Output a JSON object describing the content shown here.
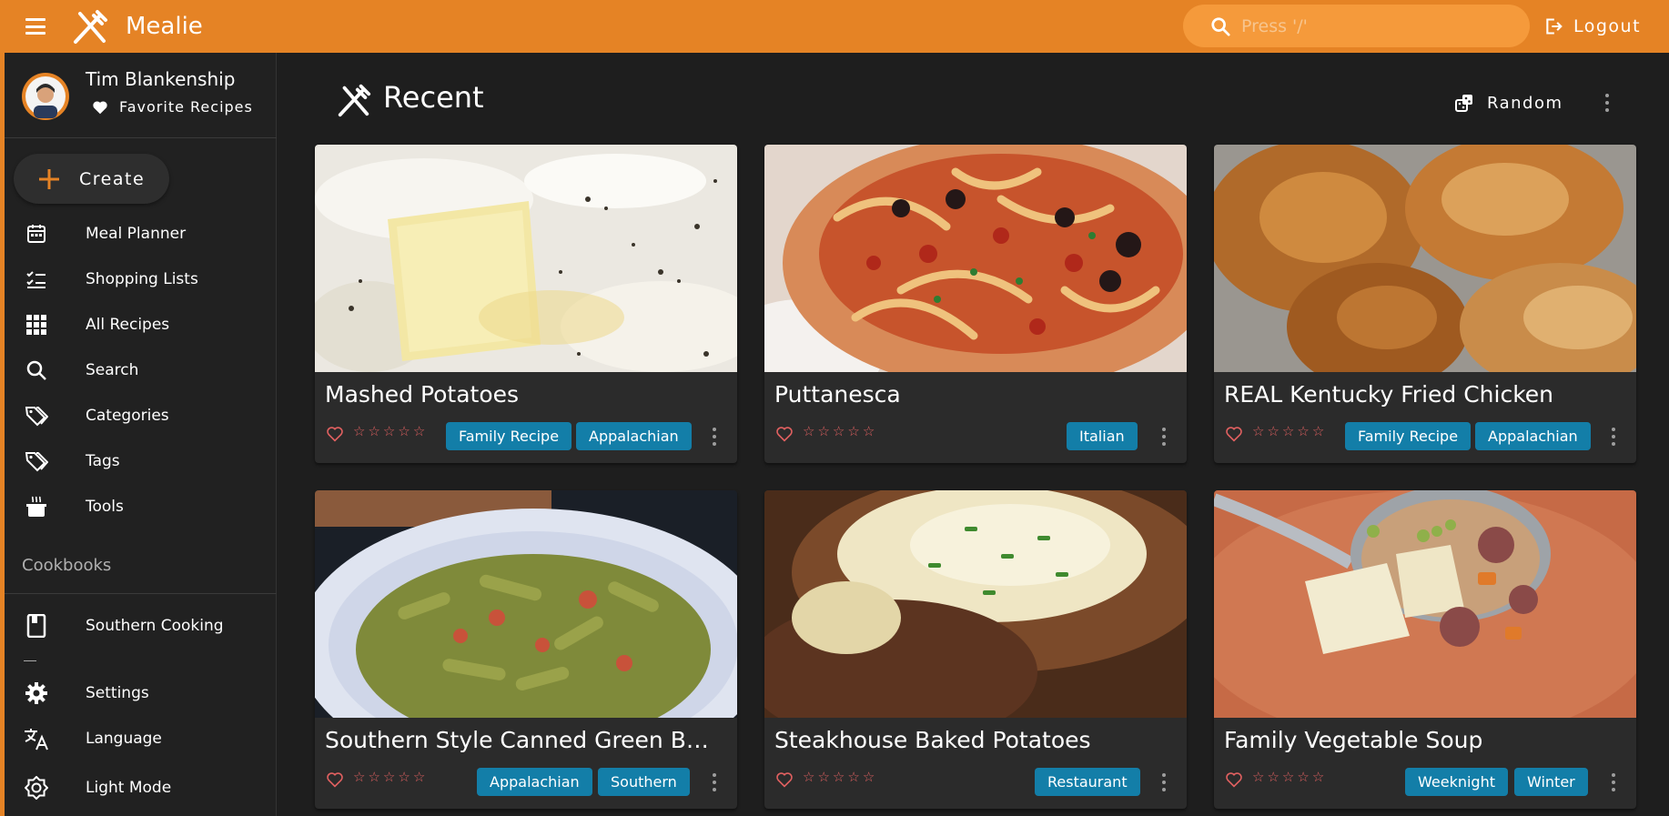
{
  "app": {
    "title": "Mealie"
  },
  "search": {
    "placeholder": "Press '/'"
  },
  "header": {
    "logout_label": "Logout"
  },
  "user": {
    "name": "Tim Blankenship",
    "favorites_label": "Favorite Recipes"
  },
  "sidebar": {
    "create_label": "Create",
    "items": [
      {
        "label": "Meal Planner",
        "icon": "calendar-icon"
      },
      {
        "label": "Shopping Lists",
        "icon": "checklist-icon"
      },
      {
        "label": "All Recipes",
        "icon": "grid-icon"
      },
      {
        "label": "Search",
        "icon": "search-icon"
      },
      {
        "label": "Categories",
        "icon": "tags-icon"
      },
      {
        "label": "Tags",
        "icon": "tags-icon"
      },
      {
        "label": "Tools",
        "icon": "pot-icon"
      }
    ],
    "cookbooks_label": "Cookbooks",
    "cookbooks": [
      {
        "label": "Southern Cooking",
        "icon": "book-icon"
      }
    ],
    "bottom": [
      {
        "label": "Settings",
        "icon": "gear-icon"
      },
      {
        "label": "Language",
        "icon": "translate-icon"
      },
      {
        "label": "Light Mode",
        "icon": "brightness-icon"
      }
    ]
  },
  "page": {
    "title": "Recent",
    "random_label": "Random"
  },
  "recipes": [
    {
      "title": "Mashed Potatoes",
      "tags": [
        "Family Recipe",
        "Appalachian"
      ],
      "rating": 0
    },
    {
      "title": "Puttanesca",
      "tags": [
        "Italian"
      ],
      "rating": 0
    },
    {
      "title": "REAL Kentucky Fried Chicken",
      "tags": [
        "Family Recipe",
        "Appalachian"
      ],
      "rating": 0
    },
    {
      "title": "Southern Style Canned Green B…",
      "tags": [
        "Appalachian",
        "Southern"
      ],
      "rating": 0
    },
    {
      "title": "Steakhouse Baked Potatoes",
      "tags": [
        "Restaurant"
      ],
      "rating": 0
    },
    {
      "title": "Family Vegetable Soup",
      "tags": [
        "Weeknight",
        "Winter"
      ],
      "rating": 0
    }
  ],
  "colors": {
    "primary": "#e58325",
    "chip": "#137ea8",
    "surface": "#2b2b2b",
    "background": "#1e1e1e",
    "star": "#e06060"
  }
}
